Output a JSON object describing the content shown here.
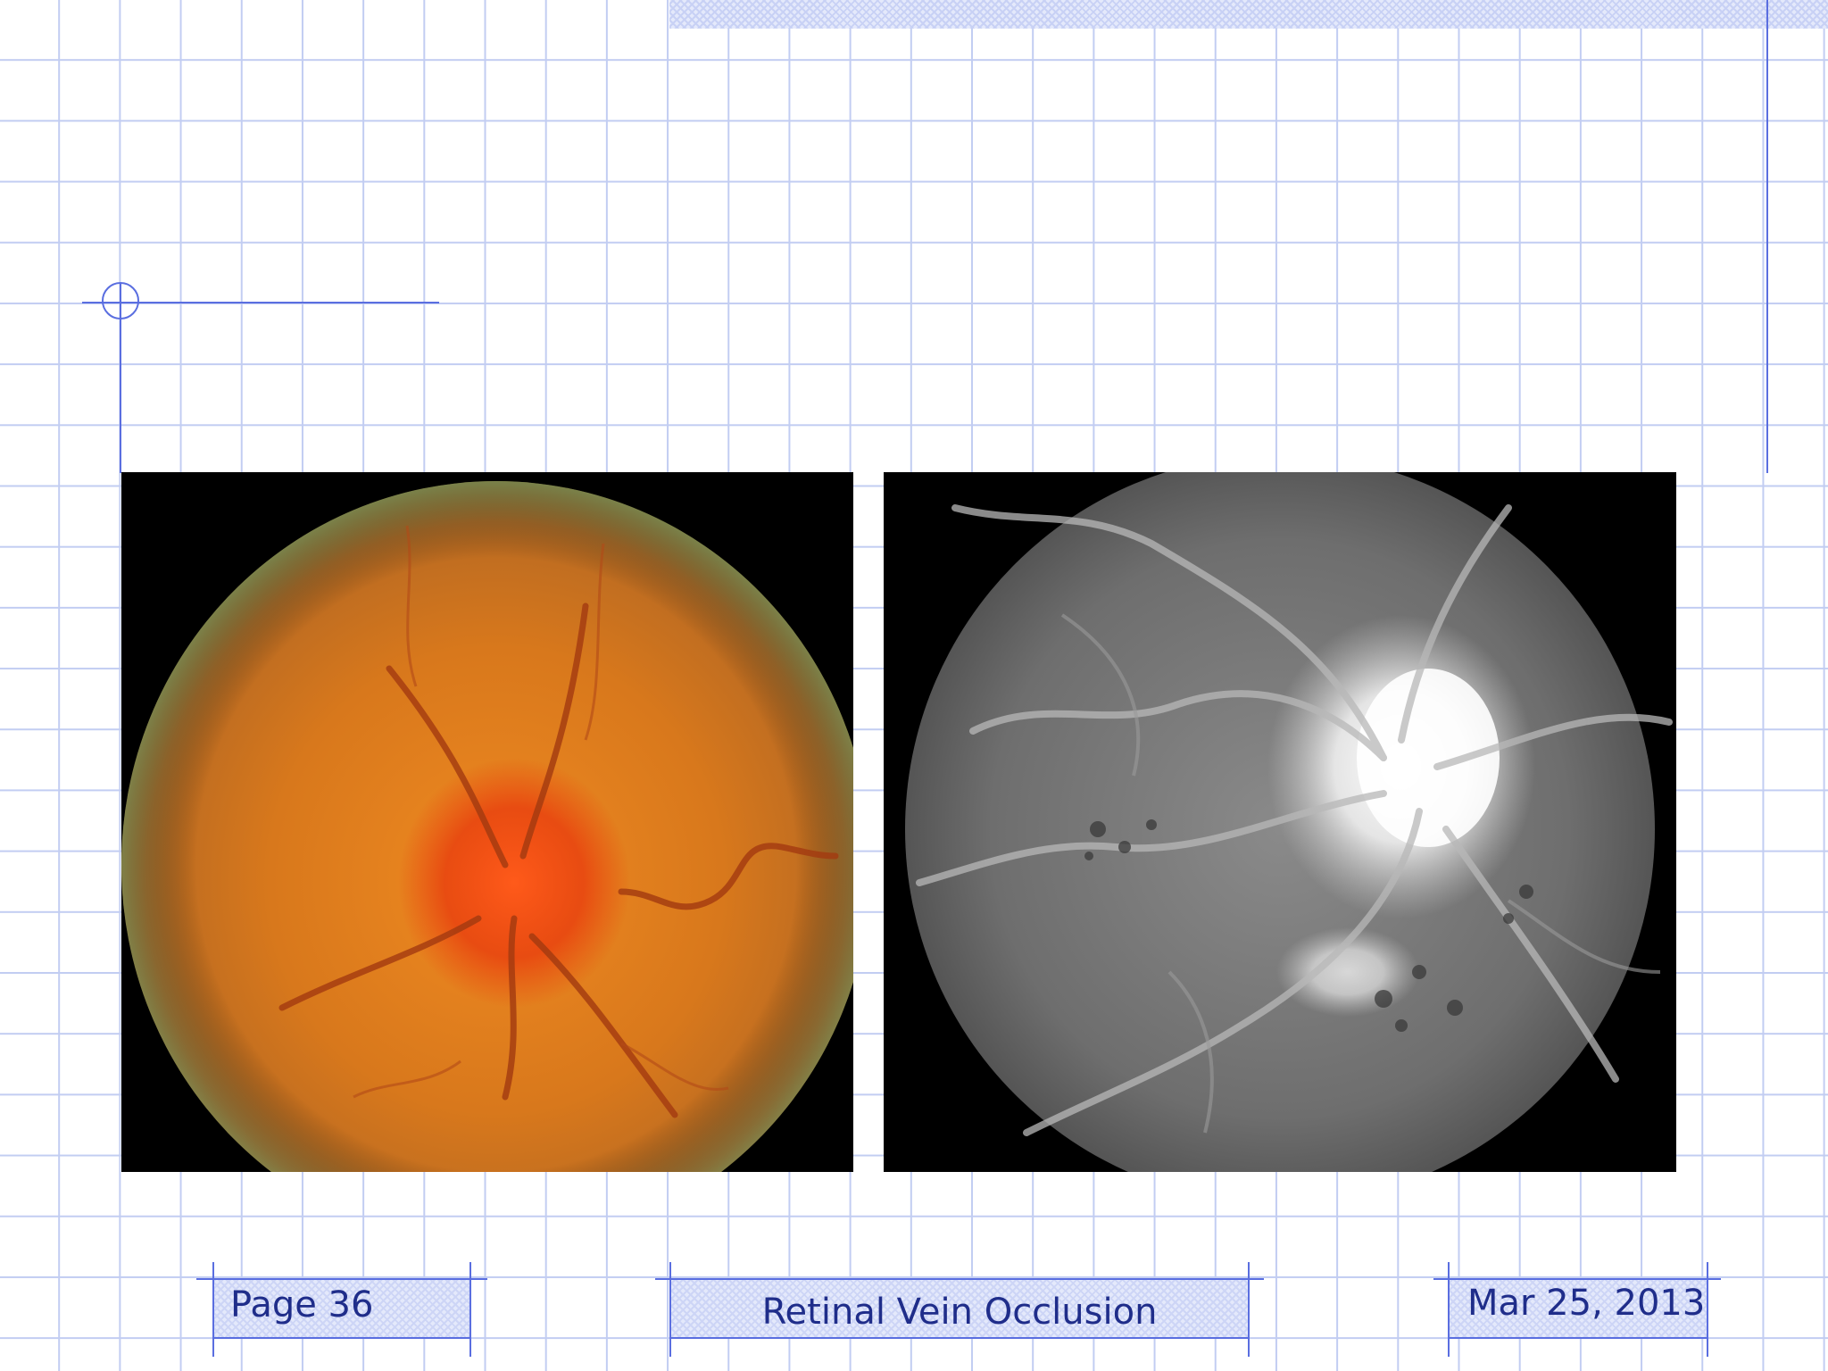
{
  "slide": {
    "images": [
      {
        "name": "color-fundus-photo",
        "description_label": ""
      },
      {
        "name": "fluorescein-angiogram-photo",
        "description_label": ""
      }
    ]
  },
  "footer": {
    "page_label": "Page 36",
    "title": "Retinal Vein Occlusion",
    "date": "Mar 25, 2013"
  },
  "colors": {
    "grid_line": "#c2cdf2",
    "accent_line": "#5a6ee0",
    "footer_text": "#1f2d8a"
  }
}
